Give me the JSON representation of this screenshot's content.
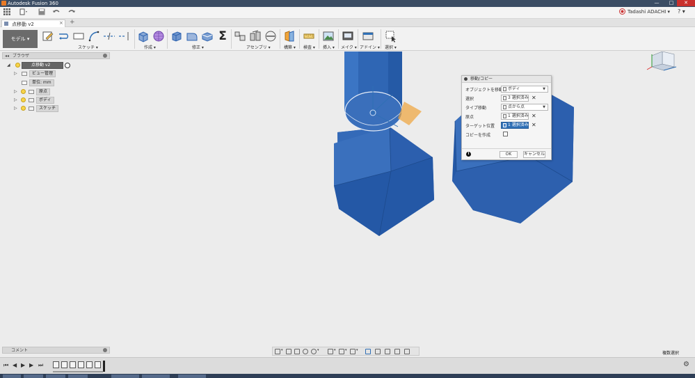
{
  "window": {
    "title": "Autodesk Fusion 360",
    "controls": {
      "minimize": "—",
      "maximize": "□",
      "close": "✕"
    }
  },
  "qat": {
    "user": "Tadashi ADACHI ▾",
    "help": "? ▾",
    "icons": [
      "grid-icon",
      "file-icon",
      "save-icon",
      "undo-icon",
      "redo-icon",
      "record-icon"
    ]
  },
  "tabs": {
    "doc_title": "点移動 v2",
    "close": "×"
  },
  "toolbar": {
    "workspace": "モデル ▾",
    "groups": {
      "sketch": "スケッチ ▾",
      "create": "作成 ▾",
      "modify": "修正 ▾",
      "assemble": "アセンブリ ▾",
      "construct": "構築 ▾",
      "inspect": "検査 ▾",
      "insert": "挿入 ▾",
      "make": "メイク ▾",
      "addins": "アドイン ▾",
      "select": "選択 ▾"
    },
    "sigma": "Σ"
  },
  "browser": {
    "title": "ブラウザ",
    "toggle": "◂◂",
    "root": "点移動 v2",
    "items": [
      {
        "label": "ビュー管理"
      },
      {
        "label": "単位: mm"
      },
      {
        "label": "原点"
      },
      {
        "label": "ボディ"
      },
      {
        "label": "スケッチ"
      }
    ]
  },
  "dialog": {
    "title": "移動/コピー",
    "rows": [
      {
        "label": "オブジェクトを移動",
        "value": "ボディ"
      },
      {
        "label": "選択",
        "value": "3 選択済み"
      },
      {
        "label": "タイプ移動",
        "value": "点から点"
      },
      {
        "label": "原点",
        "value": "1 選択済み"
      },
      {
        "label": "ターゲット位置",
        "value": "1 選択済み"
      },
      {
        "label": "コピーを作成",
        "value": ""
      }
    ],
    "ok": "OK",
    "cancel": "キャンセル",
    "info": "i",
    "x": "✕"
  },
  "comments": {
    "label": "コメント"
  },
  "status": {
    "selection_mode": "複数選択"
  },
  "timeline": {
    "buttons": [
      "⏮",
      "◀",
      "▶",
      "▶",
      "⏭"
    ],
    "settings": "⚙"
  },
  "colors": {
    "body_blue": "#2f64b0",
    "title_bar": "#3b4d64",
    "selection": "#2f6fb5",
    "construct_orange": "#f0a43a"
  }
}
